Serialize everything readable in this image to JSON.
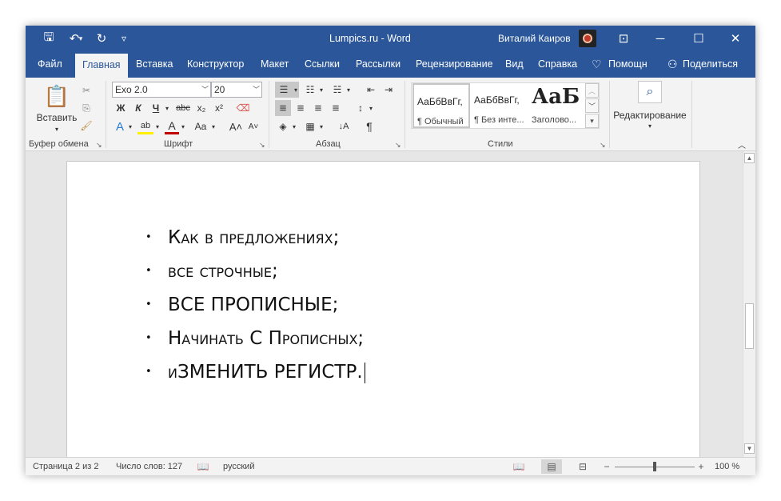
{
  "titlebar": {
    "title": "Lumpics.ru  -  Word",
    "user": "Виталий Каиров",
    "icons": [
      "save-icon",
      "undo-icon",
      "redo-icon",
      "customize-qat-icon",
      "ribbon-display-icon",
      "minimize-icon",
      "maximize-icon",
      "close-icon"
    ],
    "glyphs": {
      "save": "🖫",
      "undo": "↶",
      "undo_arrow": "▾",
      "redo": "↻",
      "qat": "▿",
      "ribbon": "⊡",
      "minimize": "─",
      "maximize": "☐",
      "close": "✕"
    }
  },
  "tabs": [
    {
      "label": "Файл"
    },
    {
      "label": "Главная"
    },
    {
      "label": "Вставка"
    },
    {
      "label": "Конструктор"
    },
    {
      "label": "Макет"
    },
    {
      "label": "Ссылки"
    },
    {
      "label": "Рассылки"
    },
    {
      "label": "Рецензирование"
    },
    {
      "label": "Вид"
    },
    {
      "label": "Справка"
    },
    {
      "label": "Помощн"
    },
    {
      "label": "Поделиться"
    }
  ],
  "tab_glyphs": {
    "lightbulb": "♡",
    "share": "⚇"
  },
  "ribbon": {
    "clipboard": {
      "label": "Буфер обмена",
      "paste_label": "Вставить",
      "paste_arrow": "▾",
      "cut": "✂",
      "copy": "⎘",
      "format_painter": "🖌"
    },
    "font": {
      "label": "Шрифт",
      "font_name": "Exo 2.0",
      "font_size": "20",
      "combo_arrow": "﹀",
      "bold": "Ж",
      "italic": "К",
      "underline": "Ч",
      "underline_arrow": "▾",
      "strike": "abc",
      "subscript": "x₂",
      "superscript": "x²",
      "clear": "⌫",
      "text_effects": "A",
      "highlight": "ab",
      "font_color": "A",
      "change_case": "Aa",
      "grow": "A˄",
      "shrink": "A˅",
      "arrow": "▾"
    },
    "paragraph": {
      "label": "Абзац",
      "bullets": "☰",
      "numbering": "☷",
      "multilevel": "☵",
      "decrease_indent": "⇤",
      "increase_indent": "⇥",
      "align_left": "≡",
      "align_center": "≡",
      "align_right": "≡",
      "justify": "≡",
      "line_spacing": "↕",
      "shading": "◈",
      "borders": "▦",
      "sort": "↓A",
      "pilcrow": "¶",
      "arrow": "▾"
    },
    "styles": {
      "label": "Стили",
      "items": [
        {
          "sample": "АаБбВвГг,",
          "name": "¶ Обычный"
        },
        {
          "sample": "АаБбВвГг,",
          "name": "¶ Без инте..."
        },
        {
          "sample": "АаБ",
          "name": "Заголово..."
        }
      ],
      "up": "︿",
      "down": "﹀",
      "more": "▾"
    },
    "editing": {
      "label": "Редактирование",
      "icon": "⌕",
      "arrow": "▾"
    },
    "collapse": "︿",
    "launcher": "↘"
  },
  "document": {
    "bullet_char": "•",
    "items": [
      {
        "text": "Как в предложениях;"
      },
      {
        "text": "все строчные;"
      },
      {
        "text": "ВСЕ ПРОПИСНЫЕ;"
      },
      {
        "text": "Начинать С Прописных;"
      },
      {
        "text": "иЗМЕНИТЬ РЕГИСТР."
      }
    ]
  },
  "scrollbar": {
    "up": "▲",
    "down": "▼"
  },
  "statusbar": {
    "page": "Страница 2 из 2",
    "words": "Число слов: 127",
    "proofing_icon": "📖",
    "language": "русский",
    "read_mode": "📖",
    "print_layout": "▤",
    "web_layout": "⊟",
    "zoom_out": "−",
    "zoom_in": "+",
    "zoom": "100 %"
  }
}
